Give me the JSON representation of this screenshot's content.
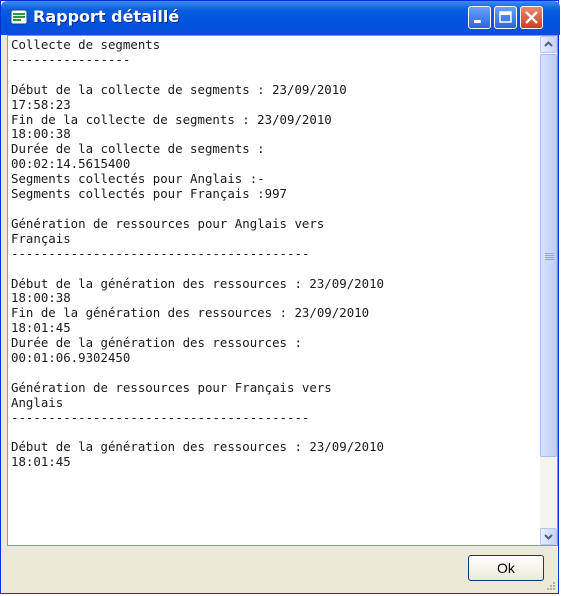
{
  "window": {
    "title": "Rapport détaillé",
    "app_icon": "report-icon",
    "controls": [
      "minimize-icon",
      "maximize-icon",
      "close-icon"
    ]
  },
  "report": {
    "lines": [
      "Collecte de segments",
      "----------------",
      "",
      "Début de la collecte de segments : 23/09/2010",
      "17:58:23",
      "Fin de la collecte de segments : 23/09/2010",
      "18:00:38",
      "Durée de la collecte de segments :",
      "00:02:14.5615400",
      "Segments collectés pour Anglais :-",
      "Segments collectés pour Français :997",
      "",
      "Génération de ressources pour Anglais vers",
      "Français",
      "----------------------------------------",
      "",
      "Début de la génération des ressources : 23/09/2010",
      "18:00:38",
      "Fin de la génération des ressources : 23/09/2010",
      "18:01:45",
      "Durée de la génération des ressources :",
      "00:01:06.9302450",
      "",
      "Génération de ressources pour Français vers",
      "Anglais",
      "----------------------------------------",
      "",
      "Début de la génération des ressources : 23/09/2010",
      "18:01:45"
    ]
  },
  "buttons": {
    "ok_label": "Ok"
  }
}
